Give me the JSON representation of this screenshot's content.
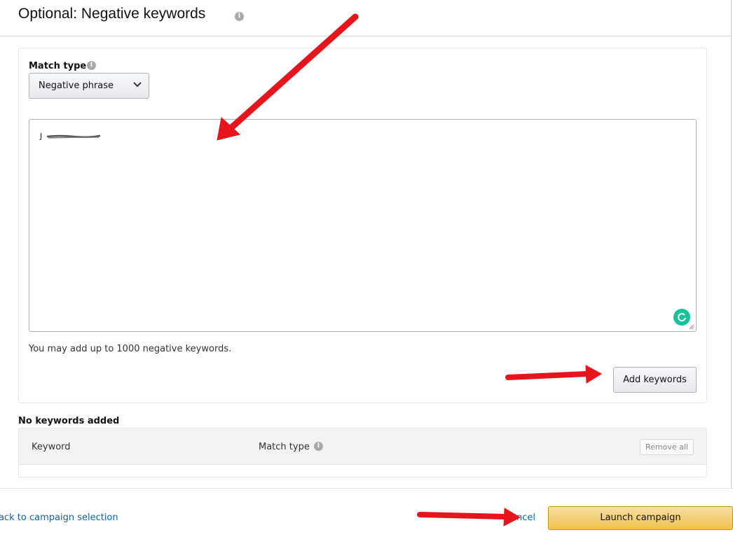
{
  "header": {
    "title": "Optional: Negative keywords",
    "info_icon": "info-icon"
  },
  "form": {
    "match_type_label": "Match type",
    "match_type_value": "Negative phrase",
    "textarea_value": "J",
    "hint": "You may add up to 1000 negative keywords.",
    "add_button": "Add keywords"
  },
  "keywords": {
    "empty_message": "No keywords added",
    "columns": [
      "Keyword",
      "Match type"
    ],
    "remove_all": "Remove all"
  },
  "footer": {
    "back_link": "ack to campaign selection",
    "cancel_link": "ncel",
    "launch_button": "Launch campaign"
  },
  "colors": {
    "annotation_arrow": "#e8141b",
    "link": "#0066c0",
    "launch_button": "#f0c14b",
    "grammarly": "#15c39a"
  }
}
